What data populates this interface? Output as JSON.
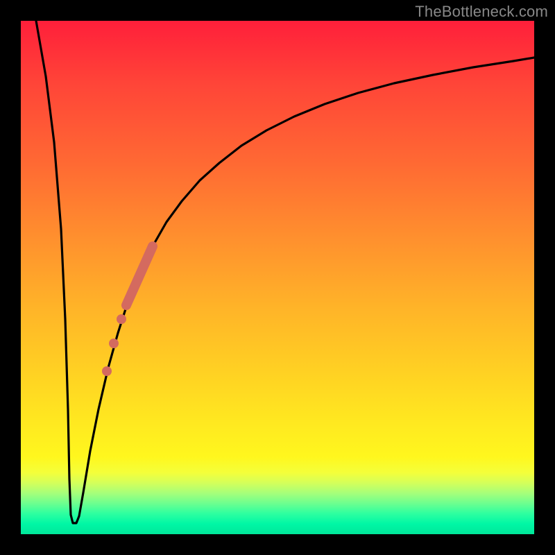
{
  "watermark": "TheBottleneck.com",
  "colors": {
    "curve": "#000000",
    "markers": "#d46a5f",
    "frame": "#000000"
  },
  "chart_data": {
    "type": "line",
    "title": "",
    "xlabel": "",
    "ylabel": "",
    "xlim": [
      0,
      100
    ],
    "ylim": [
      0,
      100
    ],
    "x": [
      0,
      2,
      4,
      6,
      8,
      9,
      10,
      11,
      12,
      14,
      16,
      18,
      20,
      22,
      24,
      26,
      28,
      30,
      34,
      38,
      42,
      46,
      50,
      55,
      60,
      65,
      70,
      75,
      80,
      85,
      90,
      95,
      100
    ],
    "values": [
      100,
      77,
      55,
      33,
      11,
      3,
      2,
      3,
      9,
      20,
      30,
      38,
      45,
      51,
      56,
      60,
      64,
      67,
      73,
      77,
      80,
      83,
      85,
      87.5,
      89.5,
      91,
      92.3,
      93.4,
      94.3,
      95,
      95.7,
      96.3,
      96.8
    ],
    "markers": [
      {
        "x": 15.5,
        "y": 27,
        "r": 1.1
      },
      {
        "x": 16.8,
        "y": 32,
        "r": 1.1
      },
      {
        "x": 18.0,
        "y": 37,
        "r": 1.1
      },
      {
        "x": 21.5,
        "y": 49,
        "r": 1.6,
        "end_x": 25.0,
        "end_y": 59,
        "is_segment": true
      }
    ],
    "note": "Bottleneck-style curve: steep descent to a trough near x≈9–10 (≈2% bottleneck), then asymptotic rise toward ~97%. Coral markers highlight a region on the rising limb around x≈15–25."
  }
}
